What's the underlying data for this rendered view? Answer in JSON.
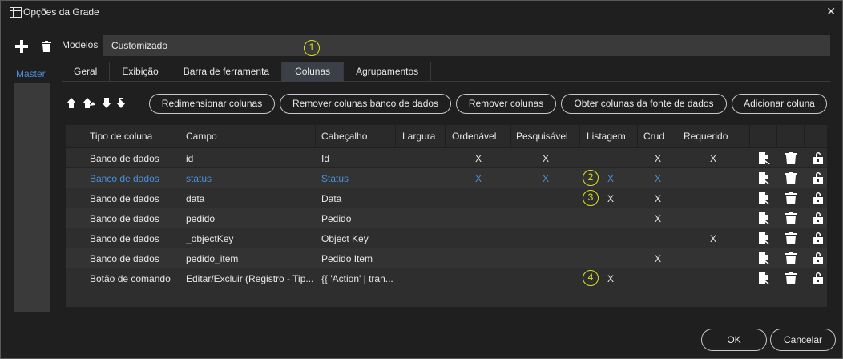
{
  "window": {
    "title": "Opções da Grade",
    "close_icon": "close-icon"
  },
  "toolbar": {
    "add_icon": "plus-icon",
    "delete_icon": "trash-icon"
  },
  "sidebar": {
    "items": [
      {
        "label": "Master"
      }
    ]
  },
  "modelos": {
    "label": "Modelos",
    "value": "Customizado"
  },
  "badges": [
    "1",
    "2",
    "3",
    "4"
  ],
  "tabs": [
    {
      "label": "Geral",
      "active": false
    },
    {
      "label": "Exibição",
      "active": false
    },
    {
      "label": "Barra de ferramenta",
      "active": false
    },
    {
      "label": "Colunas",
      "active": true
    },
    {
      "label": "Agrupamentos",
      "active": false
    }
  ],
  "move_icons": [
    "move-up-icon",
    "move-top-icon",
    "move-down-icon",
    "move-bottom-icon"
  ],
  "buttons": {
    "resize": "Redimensionar colunas",
    "remove_db": "Remover colunas banco de dados",
    "remove": "Remover colunas",
    "fetch": "Obter colunas da fonte de dados",
    "add": "Adicionar coluna"
  },
  "grid": {
    "headers": [
      "Tipo de coluna",
      "Campo",
      "Cabeçalho",
      "Largura",
      "Ordenável",
      "Pesquisável",
      "Listagem",
      "Crud",
      "Requerido"
    ],
    "rows": [
      {
        "tipo": "Banco de dados",
        "campo": "id",
        "cabecalho": "Id",
        "largura": "",
        "ordenavel": "X",
        "pesquisavel": "X",
        "listagem": "",
        "crud": "X",
        "requerido": "X"
      },
      {
        "tipo": "Banco de dados",
        "campo": "status",
        "cabecalho": "Status",
        "largura": "",
        "ordenavel": "X",
        "pesquisavel": "X",
        "listagem": "X",
        "crud": "X",
        "requerido": ""
      },
      {
        "tipo": "Banco de dados",
        "campo": "data",
        "cabecalho": "Data",
        "largura": "",
        "ordenavel": "",
        "pesquisavel": "",
        "listagem": "X",
        "crud": "X",
        "requerido": ""
      },
      {
        "tipo": "Banco de dados",
        "campo": "pedido",
        "cabecalho": "Pedido",
        "largura": "",
        "ordenavel": "",
        "pesquisavel": "",
        "listagem": "",
        "crud": "X",
        "requerido": ""
      },
      {
        "tipo": "Banco de dados",
        "campo": "_objectKey",
        "cabecalho": "Object Key",
        "largura": "",
        "ordenavel": "",
        "pesquisavel": "",
        "listagem": "",
        "crud": "",
        "requerido": "X"
      },
      {
        "tipo": "Banco de dados",
        "campo": "pedido_item",
        "cabecalho": "Pedido Item",
        "largura": "",
        "ordenavel": "",
        "pesquisavel": "",
        "listagem": "",
        "crud": "X",
        "requerido": ""
      },
      {
        "tipo": "Botão de comando",
        "campo": "Editar/Excluir (Registro - Tip...",
        "cabecalho": "{{ 'Action' | tran...",
        "largura": "",
        "ordenavel": "",
        "pesquisavel": "",
        "listagem": "X",
        "crud": "",
        "requerido": ""
      }
    ],
    "row_actions": [
      "edit-icon",
      "trash-icon",
      "lock-icon"
    ]
  },
  "footer": {
    "ok": "OK",
    "cancel": "Cancelar"
  },
  "colors": {
    "accent": "#4a90d9",
    "badge": "#d9e021",
    "background": "#1f1f1f"
  }
}
